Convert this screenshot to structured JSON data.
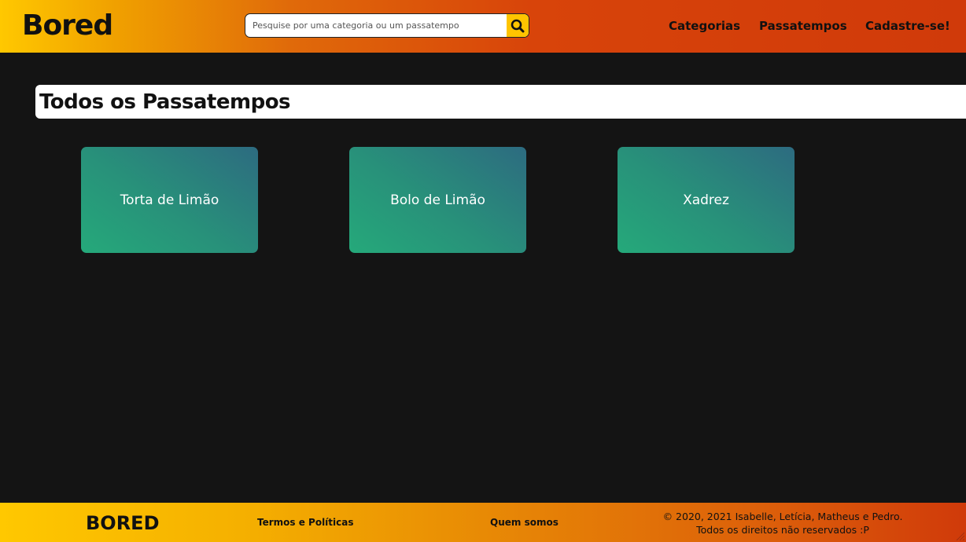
{
  "header": {
    "logo": "Bored",
    "search": {
      "placeholder": "Pesquise por uma categoria ou um passatempo",
      "value": "",
      "icon": "search-icon"
    },
    "nav": [
      {
        "label": "Categorias"
      },
      {
        "label": "Passatempos"
      },
      {
        "label": "Cadastre-se!"
      }
    ]
  },
  "main": {
    "title": "Todos os Passatempos",
    "cards": [
      {
        "label": "Torta de Limão"
      },
      {
        "label": "Bolo de Limão"
      },
      {
        "label": "Xadrez"
      }
    ]
  },
  "footer": {
    "logo": "BORED",
    "links": [
      {
        "label": "Termos e Políticas"
      },
      {
        "label": "Quem somos"
      }
    ],
    "copyright_line1": "© 2020, 2021 Isabelle, Letícia, Matheus e Pedro.",
    "copyright_line2": "Todos os direitos não reservados :P"
  },
  "colors": {
    "background": "#141414",
    "header_gradient_start": "#ffc800",
    "header_gradient_end": "#d03a0a",
    "search_button": "#ffc400",
    "card_gradient_start": "#25a97a",
    "card_gradient_end": "#2d6b80",
    "title_bar": "#ffffff"
  }
}
